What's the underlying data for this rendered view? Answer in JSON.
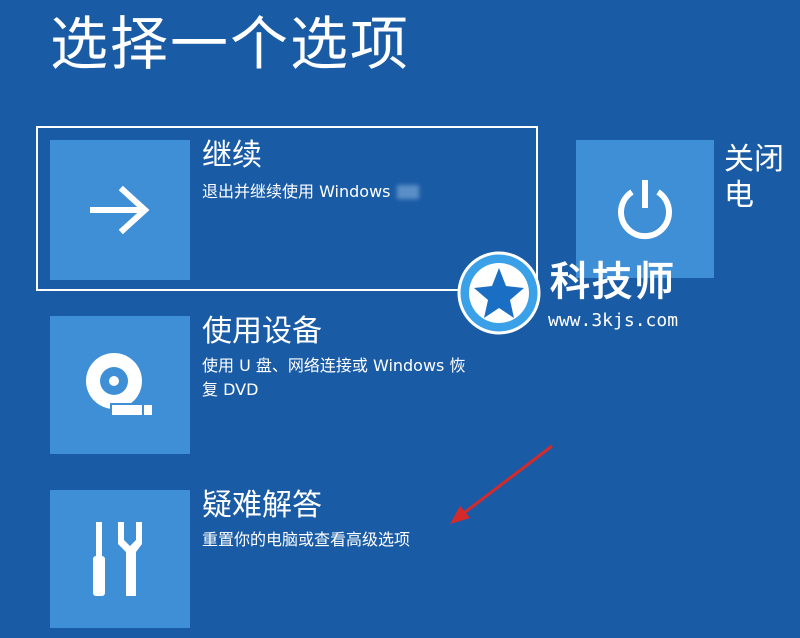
{
  "page": {
    "title": "选择一个选项"
  },
  "options": [
    {
      "title": "继续",
      "desc": "退出并继续使用 Windows",
      "icon": "arrow-right-icon"
    },
    {
      "title": "使用设备",
      "desc_line1": "使用 U 盘、网络连接或 Windows 恢",
      "desc_line2": "复 DVD",
      "icon": "disc-drive-icon"
    },
    {
      "title": "疑难解答",
      "desc": "重置你的电脑或查看高级选项",
      "icon": "tools-icon"
    }
  ],
  "right_option": {
    "title": "关闭电",
    "icon": "power-icon"
  },
  "watermark": {
    "title": "科技师",
    "url": "www.3kjs.com"
  },
  "colors": {
    "background": "#1a5ba6",
    "tile": "#3f8fd7",
    "annotation_arrow": "#d42a2a"
  }
}
